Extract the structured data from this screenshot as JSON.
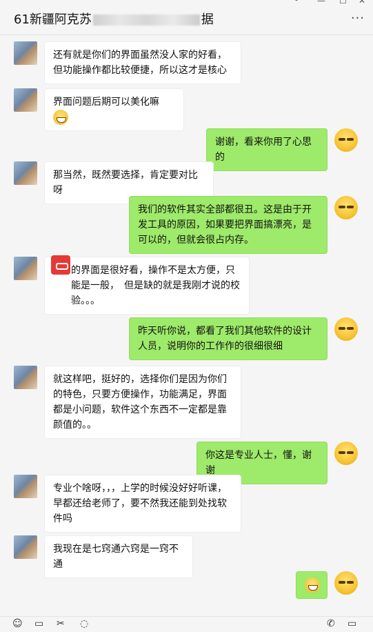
{
  "header": {
    "title_prefix": "61新疆阿克苏",
    "title_suffix": "据",
    "more": "···",
    "win_controls": [
      "﹀",
      "—",
      "☐",
      "✕"
    ]
  },
  "messages": [
    {
      "side": "left",
      "text": "还有就是你们的界面虽然没人家的好看，但功能操作都比较便捷，所以这才是核心"
    },
    {
      "side": "left",
      "text": "界面问题后期可以美化嘛",
      "emoji": "grin"
    },
    {
      "side": "right",
      "text": "谢谢，看来你用了心思的"
    },
    {
      "side": "left",
      "text": "那当然，既然要选择，肯定要对比呀"
    },
    {
      "side": "right",
      "text": "我们的软件其实全部都很丑。这是由于开发工具的原因，如果要把界面搞漂亮，是可以的，但就会很占内存。"
    },
    {
      "side": "left",
      "text": "的界面是很好看，操作不是太方便，只能是一般，　但是缺的就是我刚才说的校验。。。"
    },
    {
      "side": "right",
      "text": "昨天听你说，都看了我们其他软件的设计人员，说明你的工作作的很细很细"
    },
    {
      "side": "left",
      "text": "就这样吧，挺好的，选择你们是因为你们的特色，只要方便操作，功能满足，界面都是小问题，软件这个东西不一定都是靠颜值的。。"
    },
    {
      "side": "right",
      "text": "你这是专业人士，懂，谢谢"
    },
    {
      "side": "left",
      "text": "专业个啥呀，，，上学的时候没好好听课，早都还给老师了，要不然我还能到处找软件吗"
    },
    {
      "side": "left",
      "text": "我现在是七窍通六窍是一窍不通"
    },
    {
      "side": "right",
      "text": "",
      "emoji": "grin"
    }
  ],
  "toolbar": {
    "left_icons": [
      "emoji-icon",
      "folder-icon",
      "scissors-icon",
      "chat-icon"
    ],
    "right_icons": [
      "phone-icon",
      "video-icon"
    ],
    "glyphs": {
      "emoji": "☺",
      "folder": "▭",
      "scissors": "✂",
      "chat": "◌",
      "phone": "✆",
      "video": "▭"
    }
  },
  "colors": {
    "right_bubble": "#9eea6a",
    "left_bubble": "#ffffff",
    "background": "#f5f5f5"
  }
}
